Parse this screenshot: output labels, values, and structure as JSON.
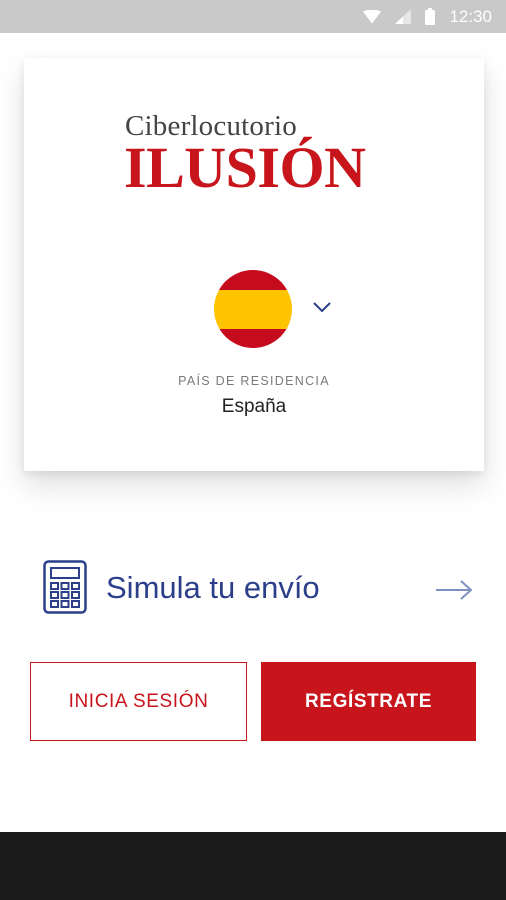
{
  "status_bar": {
    "time": "12:30",
    "icons": [
      "wifi-icon",
      "signal-icon",
      "battery-icon"
    ]
  },
  "logo": {
    "line1": "Ciberlocutorio",
    "line2": "ILUSIÓN"
  },
  "country_selector": {
    "flag": "spain-flag-icon",
    "label": "PAÍS DE RESIDENCIA",
    "value": "España"
  },
  "simulate": {
    "icon": "calculator-icon",
    "label": "Simula tu envío",
    "arrow": "arrow-right-icon"
  },
  "actions": {
    "login_label": "INICIA SESIÓN",
    "register_label": "REGÍSTRATE"
  },
  "colors": {
    "brand_red": "#c8151b",
    "brand_blue": "#2b3f8a",
    "status_bar": "#c9c9c9",
    "nav_bar": "#1b1b1b"
  }
}
